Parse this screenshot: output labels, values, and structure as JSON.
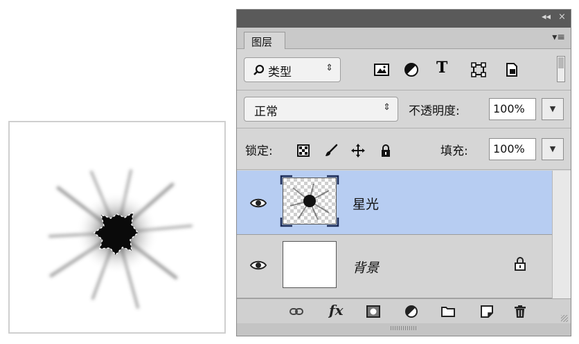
{
  "panel": {
    "collapse_glyph": "◂◂",
    "close_glyph": "×",
    "tab_label": "图层",
    "menu_glyph": "▾≡"
  },
  "filter": {
    "kind_label": "类型",
    "kind_arrow": "⇕",
    "icons": [
      "image-filter-icon",
      "adjustment-filter-icon",
      "type-filter-icon",
      "shape-filter-icon",
      "smart-object-filter-icon"
    ],
    "type_glyph": "T"
  },
  "blend": {
    "mode": "正常",
    "mode_arrow": "⇕",
    "opacity_label": "不透明度:",
    "opacity_value": "100%"
  },
  "lock": {
    "label": "锁定:",
    "fill_label": "填充:",
    "fill_value": "100%",
    "icons": [
      "lock-transparent-pixels-icon",
      "lock-image-pixels-icon",
      "lock-position-icon",
      "lock-all-icon"
    ]
  },
  "layers": [
    {
      "name": "星光",
      "selected": true,
      "visible": true,
      "locked": false
    },
    {
      "name": "背景",
      "selected": false,
      "visible": true,
      "locked": true
    }
  ],
  "bottom": {
    "fx_label": "fx",
    "icons": [
      "link-layers-icon",
      "fx-icon",
      "add-mask-icon",
      "new-adjustment-layer-icon",
      "new-group-icon",
      "new-layer-icon",
      "delete-layer-icon"
    ]
  },
  "colors": {
    "selected_row": "#b7cdf2",
    "panel_bg": "#d6d6d6",
    "title_bar": "#5a5a5a"
  }
}
